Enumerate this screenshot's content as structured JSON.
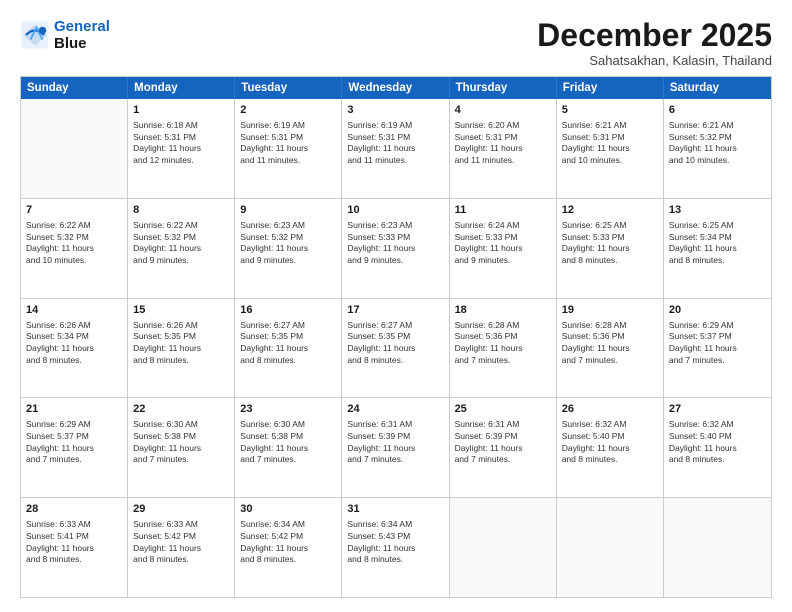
{
  "logo": {
    "line1": "General",
    "line2": "Blue"
  },
  "header": {
    "month": "December 2025",
    "location": "Sahatsakhan, Kalasin, Thailand"
  },
  "weekdays": [
    "Sunday",
    "Monday",
    "Tuesday",
    "Wednesday",
    "Thursday",
    "Friday",
    "Saturday"
  ],
  "rows": [
    [
      {
        "day": "",
        "info": ""
      },
      {
        "day": "1",
        "info": "Sunrise: 6:18 AM\nSunset: 5:31 PM\nDaylight: 11 hours\nand 12 minutes."
      },
      {
        "day": "2",
        "info": "Sunrise: 6:19 AM\nSunset: 5:31 PM\nDaylight: 11 hours\nand 11 minutes."
      },
      {
        "day": "3",
        "info": "Sunrise: 6:19 AM\nSunset: 5:31 PM\nDaylight: 11 hours\nand 11 minutes."
      },
      {
        "day": "4",
        "info": "Sunrise: 6:20 AM\nSunset: 5:31 PM\nDaylight: 11 hours\nand 11 minutes."
      },
      {
        "day": "5",
        "info": "Sunrise: 6:21 AM\nSunset: 5:31 PM\nDaylight: 11 hours\nand 10 minutes."
      },
      {
        "day": "6",
        "info": "Sunrise: 6:21 AM\nSunset: 5:32 PM\nDaylight: 11 hours\nand 10 minutes."
      }
    ],
    [
      {
        "day": "7",
        "info": "Sunrise: 6:22 AM\nSunset: 5:32 PM\nDaylight: 11 hours\nand 10 minutes."
      },
      {
        "day": "8",
        "info": "Sunrise: 6:22 AM\nSunset: 5:32 PM\nDaylight: 11 hours\nand 9 minutes."
      },
      {
        "day": "9",
        "info": "Sunrise: 6:23 AM\nSunset: 5:32 PM\nDaylight: 11 hours\nand 9 minutes."
      },
      {
        "day": "10",
        "info": "Sunrise: 6:23 AM\nSunset: 5:33 PM\nDaylight: 11 hours\nand 9 minutes."
      },
      {
        "day": "11",
        "info": "Sunrise: 6:24 AM\nSunset: 5:33 PM\nDaylight: 11 hours\nand 9 minutes."
      },
      {
        "day": "12",
        "info": "Sunrise: 6:25 AM\nSunset: 5:33 PM\nDaylight: 11 hours\nand 8 minutes."
      },
      {
        "day": "13",
        "info": "Sunrise: 6:25 AM\nSunset: 5:34 PM\nDaylight: 11 hours\nand 8 minutes."
      }
    ],
    [
      {
        "day": "14",
        "info": "Sunrise: 6:26 AM\nSunset: 5:34 PM\nDaylight: 11 hours\nand 8 minutes."
      },
      {
        "day": "15",
        "info": "Sunrise: 6:26 AM\nSunset: 5:35 PM\nDaylight: 11 hours\nand 8 minutes."
      },
      {
        "day": "16",
        "info": "Sunrise: 6:27 AM\nSunset: 5:35 PM\nDaylight: 11 hours\nand 8 minutes."
      },
      {
        "day": "17",
        "info": "Sunrise: 6:27 AM\nSunset: 5:35 PM\nDaylight: 11 hours\nand 8 minutes."
      },
      {
        "day": "18",
        "info": "Sunrise: 6:28 AM\nSunset: 5:36 PM\nDaylight: 11 hours\nand 7 minutes."
      },
      {
        "day": "19",
        "info": "Sunrise: 6:28 AM\nSunset: 5:36 PM\nDaylight: 11 hours\nand 7 minutes."
      },
      {
        "day": "20",
        "info": "Sunrise: 6:29 AM\nSunset: 5:37 PM\nDaylight: 11 hours\nand 7 minutes."
      }
    ],
    [
      {
        "day": "21",
        "info": "Sunrise: 6:29 AM\nSunset: 5:37 PM\nDaylight: 11 hours\nand 7 minutes."
      },
      {
        "day": "22",
        "info": "Sunrise: 6:30 AM\nSunset: 5:38 PM\nDaylight: 11 hours\nand 7 minutes."
      },
      {
        "day": "23",
        "info": "Sunrise: 6:30 AM\nSunset: 5:38 PM\nDaylight: 11 hours\nand 7 minutes."
      },
      {
        "day": "24",
        "info": "Sunrise: 6:31 AM\nSunset: 5:39 PM\nDaylight: 11 hours\nand 7 minutes."
      },
      {
        "day": "25",
        "info": "Sunrise: 6:31 AM\nSunset: 5:39 PM\nDaylight: 11 hours\nand 7 minutes."
      },
      {
        "day": "26",
        "info": "Sunrise: 6:32 AM\nSunset: 5:40 PM\nDaylight: 11 hours\nand 8 minutes."
      },
      {
        "day": "27",
        "info": "Sunrise: 6:32 AM\nSunset: 5:40 PM\nDaylight: 11 hours\nand 8 minutes."
      }
    ],
    [
      {
        "day": "28",
        "info": "Sunrise: 6:33 AM\nSunset: 5:41 PM\nDaylight: 11 hours\nand 8 minutes."
      },
      {
        "day": "29",
        "info": "Sunrise: 6:33 AM\nSunset: 5:42 PM\nDaylight: 11 hours\nand 8 minutes."
      },
      {
        "day": "30",
        "info": "Sunrise: 6:34 AM\nSunset: 5:42 PM\nDaylight: 11 hours\nand 8 minutes."
      },
      {
        "day": "31",
        "info": "Sunrise: 6:34 AM\nSunset: 5:43 PM\nDaylight: 11 hours\nand 8 minutes."
      },
      {
        "day": "",
        "info": ""
      },
      {
        "day": "",
        "info": ""
      },
      {
        "day": "",
        "info": ""
      }
    ]
  ]
}
